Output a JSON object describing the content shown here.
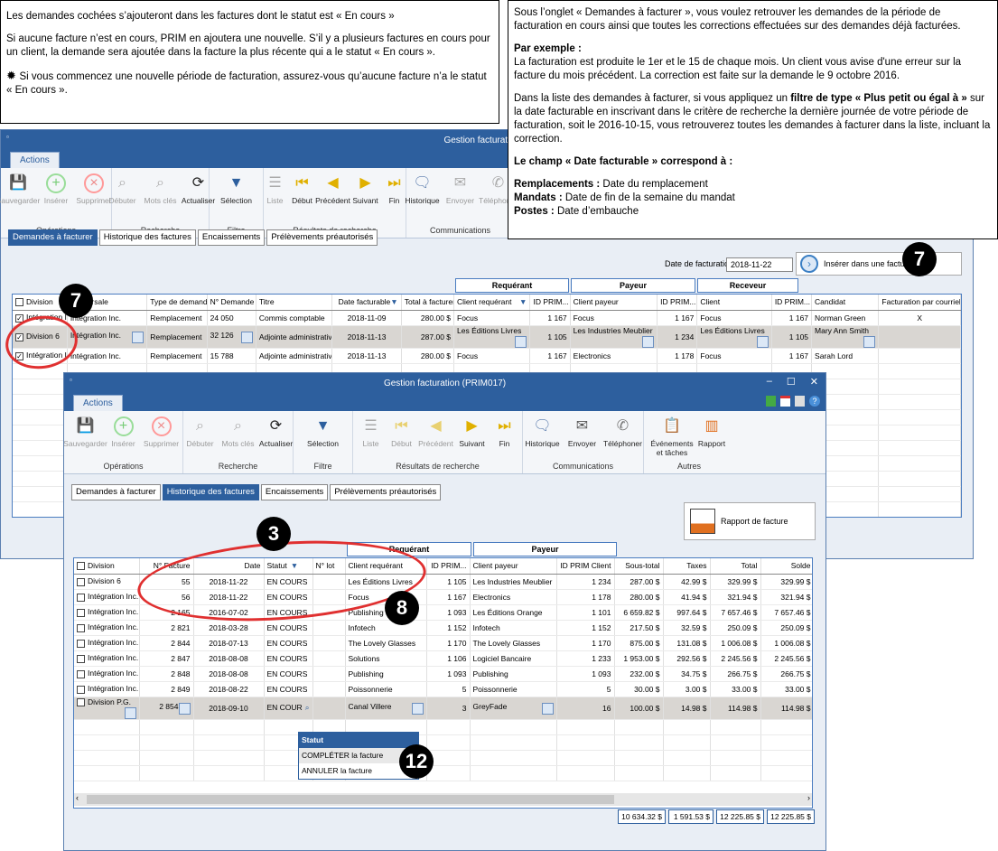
{
  "note_left": {
    "p1": "Les demandes cochées s’ajouteront dans les factures dont le statut est « En cours »",
    "p2": "Si aucune facture n’est en cours, PRIM en ajoutera une nouvelle. S’il y a plusieurs factures en cours pour un client, la demande sera ajoutée dans la facture la plus récente qui a le statut « En cours ».",
    "p3": "Si vous commencez une nouvelle période de facturation, assurez-vous qu’aucune facture n’a le statut « En cours »."
  },
  "note_right": {
    "p1": "Sous l’onglet « Demandes à facturer », vous voulez retrouver les demandes de la période de facturation en cours ainsi que toutes les corrections effectuées sur des demandes déjà facturées.",
    "ex_title": "Par exemple :",
    "ex_body": "La facturation est produite le 1er et le 15 de chaque mois. Un client vous avise d'une erreur sur la facture du mois précédent. La correction est faite sur la demande le 9 octobre 2016.",
    "p3a": "Dans la liste des demandes à facturer, si vous appliquez un ",
    "p3b": "filtre de type « Plus petit ou égal à »",
    "p3c": " sur la date facturable en inscrivant dans le critère de recherche la dernière journée de votre période de facturation, soit le 2016-10-15, vous retrouverez toutes les demandes à facturer dans la liste, incluant la correction.",
    "champ": "Le champ « Date facturable » correspond à :",
    "l1a": "Remplacements :",
    "l1b": " Date du remplacement",
    "l2a": "Mandats :",
    "l2b": " Date de fin de la semaine du mandat",
    "l3a": "Postes :",
    "l3b": " Date d’embauche"
  },
  "win_back": {
    "title": "Gestion facturation (PRIM017)",
    "tab_actions": "Actions",
    "tabs": [
      "Demandes à facturer",
      "Historique des factures",
      "Encaissements",
      "Prélèvements préautorisés"
    ],
    "date_label": "Date de facturation",
    "date_value": "2018-11-22",
    "insert_btn": "Insérer dans une facture",
    "group_heads": [
      "Requérant",
      "Payeur",
      "Receveur"
    ],
    "columns": [
      "Division",
      "Succursale",
      "Type de demande",
      "N° Demande",
      "Titre",
      "Date facturable",
      "Total à facturer",
      "Client requérant",
      "ID PRIM...",
      "Client payeur",
      "ID PRIM...",
      "Client",
      "ID PRIM...",
      "Candidat",
      "Facturation par courriel"
    ],
    "rows": [
      [
        "Intégration Inc.",
        "Intégration Inc.",
        "Remplacement",
        "24 050",
        "Commis comptable",
        "2018-11-09",
        "280.00 $",
        "Focus",
        "1 167",
        "Focus",
        "1 167",
        "Focus",
        "1 167",
        "Norman Green",
        "X"
      ],
      [
        "Division 6",
        "Intégration Inc.",
        "Remplacement",
        "32 126",
        "Adjointe administrative",
        "2018-11-13",
        "287.00 $",
        "Les Éditions Livres",
        "1 105",
        "Les Industries Meublier",
        "1 234",
        "Les Éditions Livres",
        "1 105",
        "Mary Ann Smith",
        ""
      ],
      [
        "Intégration Inc.",
        "Intégration Inc.",
        "Remplacement",
        "15 788",
        "Adjointe administrative",
        "2018-11-13",
        "280.00 $",
        "Focus",
        "1 167",
        "Electronics",
        "1 178",
        "Focus",
        "1 167",
        "Sarah Lord",
        ""
      ]
    ]
  },
  "ribbon": {
    "ops": [
      "Sauvegarder",
      "Insérer",
      "Supprimer"
    ],
    "ops_label": "Opérations",
    "search": [
      "Débuter",
      "Mots clés",
      "Actualiser"
    ],
    "search_label": "Recherche",
    "filter": [
      "Sélection"
    ],
    "filter_label": "Filtre",
    "results": [
      "Liste",
      "Début",
      "Précédent",
      "Suivant",
      "Fin"
    ],
    "results_label": "Résultats de recherche",
    "comm": [
      "Historique",
      "Envoyer",
      "Téléphoner"
    ],
    "comm_label": "Communications",
    "other": [
      "Événements et tâches",
      "Rapport"
    ],
    "other_label": "Autres"
  },
  "win_front": {
    "title": "Gestion facturation (PRIM017)",
    "tab_actions": "Actions",
    "tabs": [
      "Demandes à facturer",
      "Historique des factures",
      "Encaissements",
      "Prélèvements préautorisés"
    ],
    "report_btn": "Rapport de facture",
    "group_heads": [
      "Requérant",
      "Payeur"
    ],
    "columns": [
      "Division",
      "N° Facture",
      "Date",
      "Statut",
      "N° lot",
      "Client requérant",
      "ID PRIM...",
      "Client payeur",
      "ID PRIM Client",
      "Sous-total",
      "Taxes",
      "Total",
      "Solde"
    ],
    "rows": [
      [
        "Division 6",
        "55",
        "2018-11-22",
        "EN COURS",
        "",
        "Les Éditions Livres",
        "1 105",
        "Les Industries Meublier",
        "1 234",
        "287.00 $",
        "42.99 $",
        "329.99 $",
        "329.99 $"
      ],
      [
        "Intégration Inc.",
        "56",
        "2018-11-22",
        "EN COURS",
        "",
        "Focus",
        "1 167",
        "Electronics",
        "1 178",
        "280.00 $",
        "41.94 $",
        "321.94 $",
        "321.94 $"
      ],
      [
        "Intégration Inc.",
        "2 165",
        "2016-07-02",
        "EN COURS",
        "",
        "Publishing",
        "1 093",
        "Les Éditions Orange",
        "1 101",
        "6 659.82 $",
        "997.64 $",
        "7 657.46 $",
        "7 657.46 $"
      ],
      [
        "Intégration Inc.",
        "2 821",
        "2018-03-28",
        "EN COURS",
        "",
        "Infotech",
        "1 152",
        "Infotech",
        "1 152",
        "217.50 $",
        "32.59 $",
        "250.09 $",
        "250.09 $"
      ],
      [
        "Intégration Inc.",
        "2 844",
        "2018-07-13",
        "EN COURS",
        "",
        "The Lovely Glasses",
        "1 170",
        "The Lovely Glasses",
        "1 170",
        "875.00 $",
        "131.08 $",
        "1 006.08 $",
        "1 006.08 $"
      ],
      [
        "Intégration Inc.",
        "2 847",
        "2018-08-08",
        "EN COURS",
        "",
        "Solutions",
        "1 106",
        "Logiciel Bancaire",
        "1 233",
        "1 953.00 $",
        "292.56 $",
        "2 245.56 $",
        "2 245.56 $"
      ],
      [
        "Intégration Inc.",
        "2 848",
        "2018-08-08",
        "EN COURS",
        "",
        "Publishing",
        "1 093",
        "Publishing",
        "1 093",
        "232.00 $",
        "34.75 $",
        "266.75 $",
        "266.75 $"
      ],
      [
        "Intégration Inc.",
        "2 849",
        "2018-08-22",
        "EN COURS",
        "",
        "Poissonnerie",
        "5",
        "Poissonnerie",
        "5",
        "30.00 $",
        "3.00 $",
        "33.00 $",
        "33.00 $"
      ],
      [
        "Division P.G.",
        "2 854",
        "2018-09-10",
        "EN COUR",
        "",
        "Canal Villere",
        "3",
        "GreyFade",
        "16",
        "100.00 $",
        "14.98 $",
        "114.98 $",
        "114.98 $"
      ]
    ],
    "dropdown": {
      "header": "Statut",
      "items": [
        "COMPLÉTER la facture",
        "ANNULER la facture"
      ]
    },
    "totals": [
      "10 634.32 $",
      "1 591.53 $",
      "12 225.85 $",
      "12 225.85 $"
    ]
  },
  "badges": [
    "7",
    "7",
    "3",
    "8",
    "12"
  ]
}
